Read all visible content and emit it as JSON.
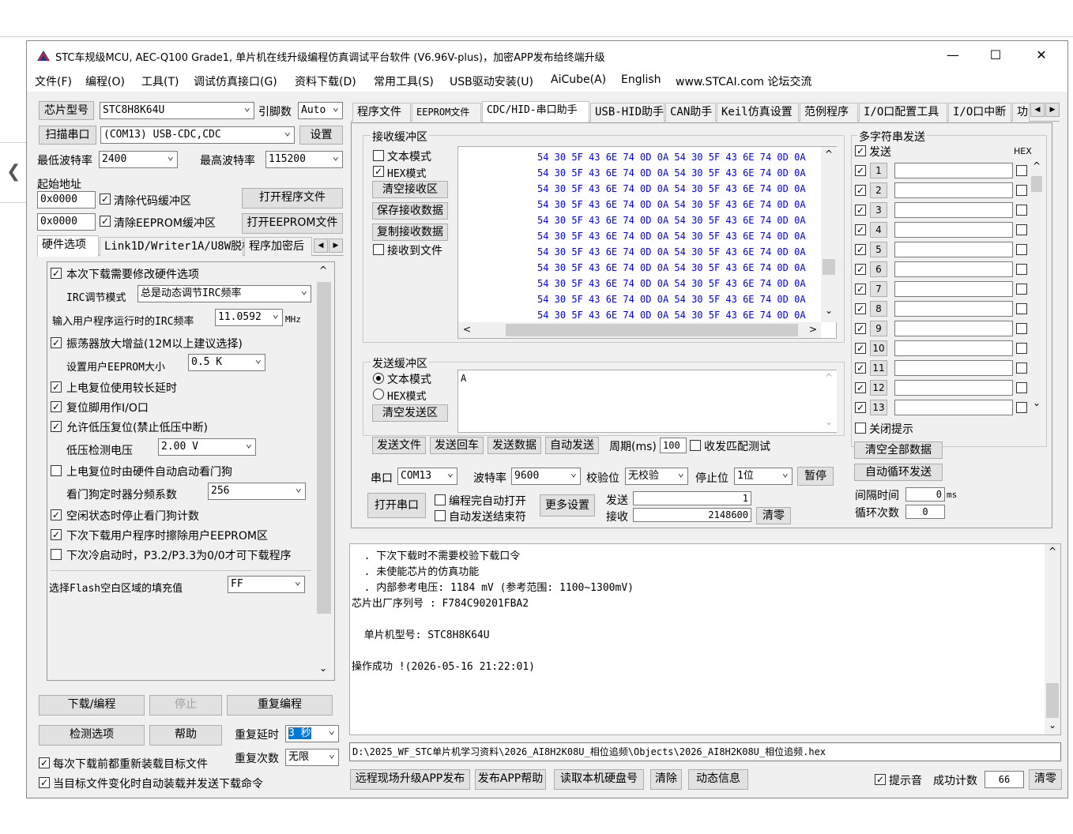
{
  "window": {
    "title": "STC车规级MCU, AEC-Q100 Grade1, 单片机在线升级编程仿真调试平台软件 (V6.96V-plus)，加密APP发布给终端升级",
    "minimize": "—",
    "maximize": "☐",
    "close": "✕"
  },
  "menu": [
    "文件(F)",
    "编程(O)",
    "工具(T)",
    "调试仿真接口(G)",
    "资料下载(D)",
    "常用工具(S)",
    "USB驱动安装(U)",
    "AiCube(A)",
    "English",
    "www.STCAI.com 论坛交流"
  ],
  "left": {
    "chip_label": "芯片型号",
    "chip_value": "STC8H8K64U",
    "pin_label": "引脚数",
    "pin_value": "Auto",
    "scan_label": "扫描串口",
    "port_value": "(COM13) USB-CDC,CDC",
    "settings_label": "设置",
    "min_baud_label": "最低波特率",
    "min_baud_value": "2400",
    "max_baud_label": "最高波特率",
    "max_baud_value": "115200",
    "start_addr_label": "起始地址",
    "addr1": "0x0000",
    "addr2": "0x0000",
    "clear_code": "清除代码缓冲区",
    "clear_eeprom": "清除EEPROM缓冲区",
    "open_prog": "打开程序文件",
    "open_eeprom": "打开EEPROM文件",
    "tabs": [
      "硬件选项",
      "Link1D/Writer1A/U8W脱机",
      "程序加密后"
    ],
    "opt_modify_hw": "本次下载需要修改硬件选项",
    "irc_mode_label": "IRC调节模式",
    "irc_mode_value": "总是动态调节IRC频率",
    "irc_freq_label": "输入用户程序运行时的IRC频率",
    "irc_freq_value": "11.0592",
    "irc_unit": "MHz",
    "osc_gain": "振荡器放大增益(12M以上建议选择)",
    "eeprom_size_label": "设置用户EEPROM大小",
    "eeprom_size_value": "0.5 K",
    "long_delay": "上电复位使用较长延时",
    "reset_io": "复位脚用作I/O口",
    "lvr": "允许低压复位(禁止低压中断)",
    "lv_label": "低压检测电压",
    "lv_value": "2.00 V",
    "wdt_auto": "上电复位时由硬件自动启动看门狗",
    "wdt_div_label": "看门狗定时器分频系数",
    "wdt_div_value": "256",
    "idle_wdt": "空闲状态时停止看门狗计数",
    "erase_eeprom": "下次下载用户程序时擦除用户EEPROM区",
    "p32": "下次冷启动时，P3.2/P3.3为0/0才可下载程序",
    "fill_label": "选择Flash空白区域的填充值",
    "fill_value": "FF",
    "download": "下载/编程",
    "stop": "停止",
    "reprogram": "重复编程",
    "check": "检测选项",
    "help": "帮助",
    "delay_label": "重复延时",
    "delay_value": "3 秒",
    "count_label": "重复次数",
    "count_value": "无限",
    "reload": "每次下载前都重新装载目标文件",
    "auto_send": "当目标文件变化时自动装载并发送下载命令"
  },
  "right_tabs": [
    "程序文件",
    "EEPROM文件",
    "CDC/HID-串口助手",
    "USB-HID助手",
    "CAN助手",
    "Keil仿真设置",
    "范例程序",
    "I/O口配置工具",
    "I/O口中断",
    "功"
  ],
  "recv": {
    "title": "接收缓冲区",
    "text_mode": "文本模式",
    "hex_mode": "HEX模式",
    "clear": "清空接收区",
    "save": "保存接收数据",
    "copy": "复制接收数据",
    "to_file": "接收到文件",
    "row": "54 30 5F 43 6E 74 0D 0A 54 30 5F 43 6E 74 0D 0A"
  },
  "send": {
    "title": "发送缓冲区",
    "text_mode": "文本模式",
    "hex_mode": "HEX模式",
    "clear": "清空发送区",
    "content": "A",
    "send_file": "发送文件",
    "send_enter": "发送回车",
    "send_data": "发送数据",
    "auto_send": "自动发送",
    "period_label": "周期(ms)",
    "period_value": "100",
    "match_test": "收发匹配测试"
  },
  "serial": {
    "port_label": "串口",
    "port_value": "COM13",
    "baud_label": "波特率",
    "baud_value": "9600",
    "parity_label": "校验位",
    "parity_value": "无校验",
    "stop_label": "停止位",
    "stop_value": "1位",
    "pause": "暂停",
    "open": "打开串口",
    "auto_open": "编程完自动打开",
    "auto_end": "自动发送结束符",
    "more": "更多设置",
    "tx_label": "发送",
    "tx_value": "1",
    "rx_label": "接收",
    "rx_value": "2148600",
    "clear": "清零"
  },
  "multi": {
    "title": "多字符串发送",
    "send_label": "发送",
    "hex_label": "HEX",
    "nums": [
      "1",
      "2",
      "3",
      "4",
      "5",
      "6",
      "7",
      "8",
      "9",
      "10",
      "11",
      "12",
      "13"
    ],
    "close_tip": "关闭提示",
    "clear_all": "清空全部数据",
    "auto_loop": "自动循环发送",
    "interval_label": "间隔时间",
    "interval_value": "0",
    "interval_unit": "ms",
    "loop_label": "循环次数",
    "loop_value": "0"
  },
  "log": {
    "l1": "  . 下次下载时不需要校验下载口令",
    "l2": "  . 未使能芯片的仿真功能",
    "l3": "  . 内部参考电压: 1184 mV (参考范围: 1100~1300mV)",
    "l4": "芯片出厂序列号 : F784C90201FBA2",
    "l5": "  单片机型号: STC8H8K64U",
    "l6": "操作成功 !(2026-05-16 21:22:01)"
  },
  "path": "D:\\2025_WF_STC单片机学习资料\\2026_AI8H2K08U_相位追频\\Objects\\2026_AI8H2K08U_相位追频.hex",
  "bottom": {
    "remote": "远程现场升级APP发布",
    "app_help": "发布APP帮助",
    "read_disk": "读取本机硬盘号",
    "clear": "清除",
    "dyn": "动态信息",
    "beep": "提示音",
    "success_label": "成功计数",
    "success_value": "66",
    "reset": "清零"
  }
}
